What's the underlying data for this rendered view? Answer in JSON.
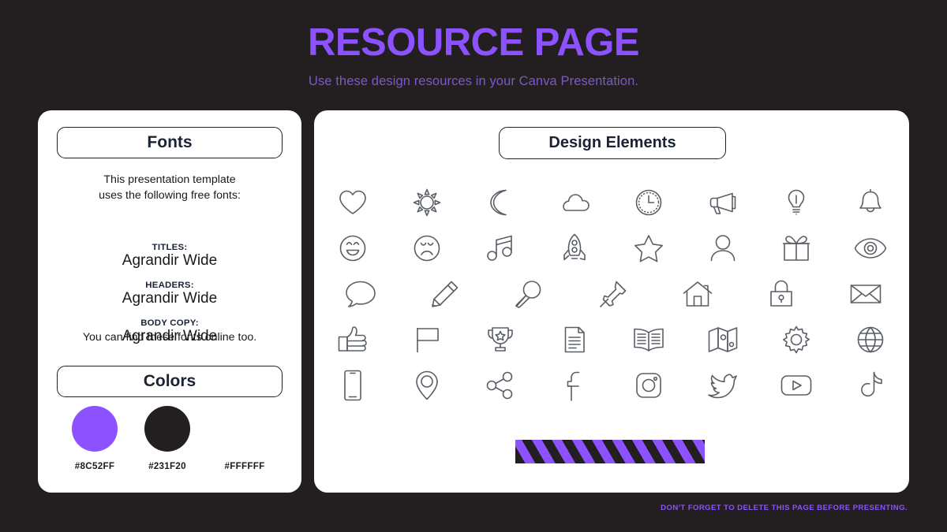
{
  "header": {
    "title": "RESOURCE PAGE",
    "subtitle": "Use these design resources in your Canva Presentation."
  },
  "fonts_card": {
    "pill_label": "Fonts",
    "intro": "This presentation template\nuses the following free fonts:",
    "entries": [
      {
        "label": "TITLES:",
        "value": "Agrandir Wide"
      },
      {
        "label": "HEADERS:",
        "value": "Agrandir Wide"
      },
      {
        "label": "BODY COPY:",
        "value": "Agrandir Wide"
      }
    ],
    "outro": "You can find these fonts online too."
  },
  "colors_card": {
    "pill_label": "Colors",
    "swatches": [
      {
        "hex": "#8C52FF",
        "label": "#8C52FF",
        "visible": true
      },
      {
        "hex": "#231F20",
        "label": "#231F20",
        "visible": true
      },
      {
        "hex": "#FFFFFF",
        "label": "#FFFFFF",
        "visible": false
      }
    ]
  },
  "elements_card": {
    "pill_label": "Design Elements",
    "icon_rows": [
      [
        "heart-icon",
        "sun-icon",
        "moon-icon",
        "cloud-icon",
        "clock-icon",
        "megaphone-icon",
        "lightbulb-icon",
        "bell-icon"
      ],
      [
        "smiley-happy-icon",
        "smiley-sad-icon",
        "music-note-icon",
        "rocket-icon",
        "star-icon",
        "person-icon",
        "gift-icon",
        "eye-icon"
      ],
      [
        "speech-bubble-icon",
        "pencil-icon",
        "magnifier-icon",
        "pushpin-icon",
        "house-icon",
        "lock-icon",
        "envelope-icon"
      ],
      [
        "thumbs-up-icon",
        "flag-icon",
        "trophy-icon",
        "document-icon",
        "book-icon",
        "map-icon",
        "gear-icon",
        "globe-icon"
      ],
      [
        "smartphone-icon",
        "location-pin-icon",
        "share-icon",
        "facebook-icon",
        "instagram-icon",
        "twitter-icon",
        "youtube-icon",
        "tiktok-icon"
      ]
    ],
    "banner": {
      "stripe_colors": [
        "#231F20",
        "#8C52FF"
      ]
    }
  },
  "footer": {
    "note": "DON'T FORGET TO DELETE THIS PAGE BEFORE PRESENTING."
  }
}
